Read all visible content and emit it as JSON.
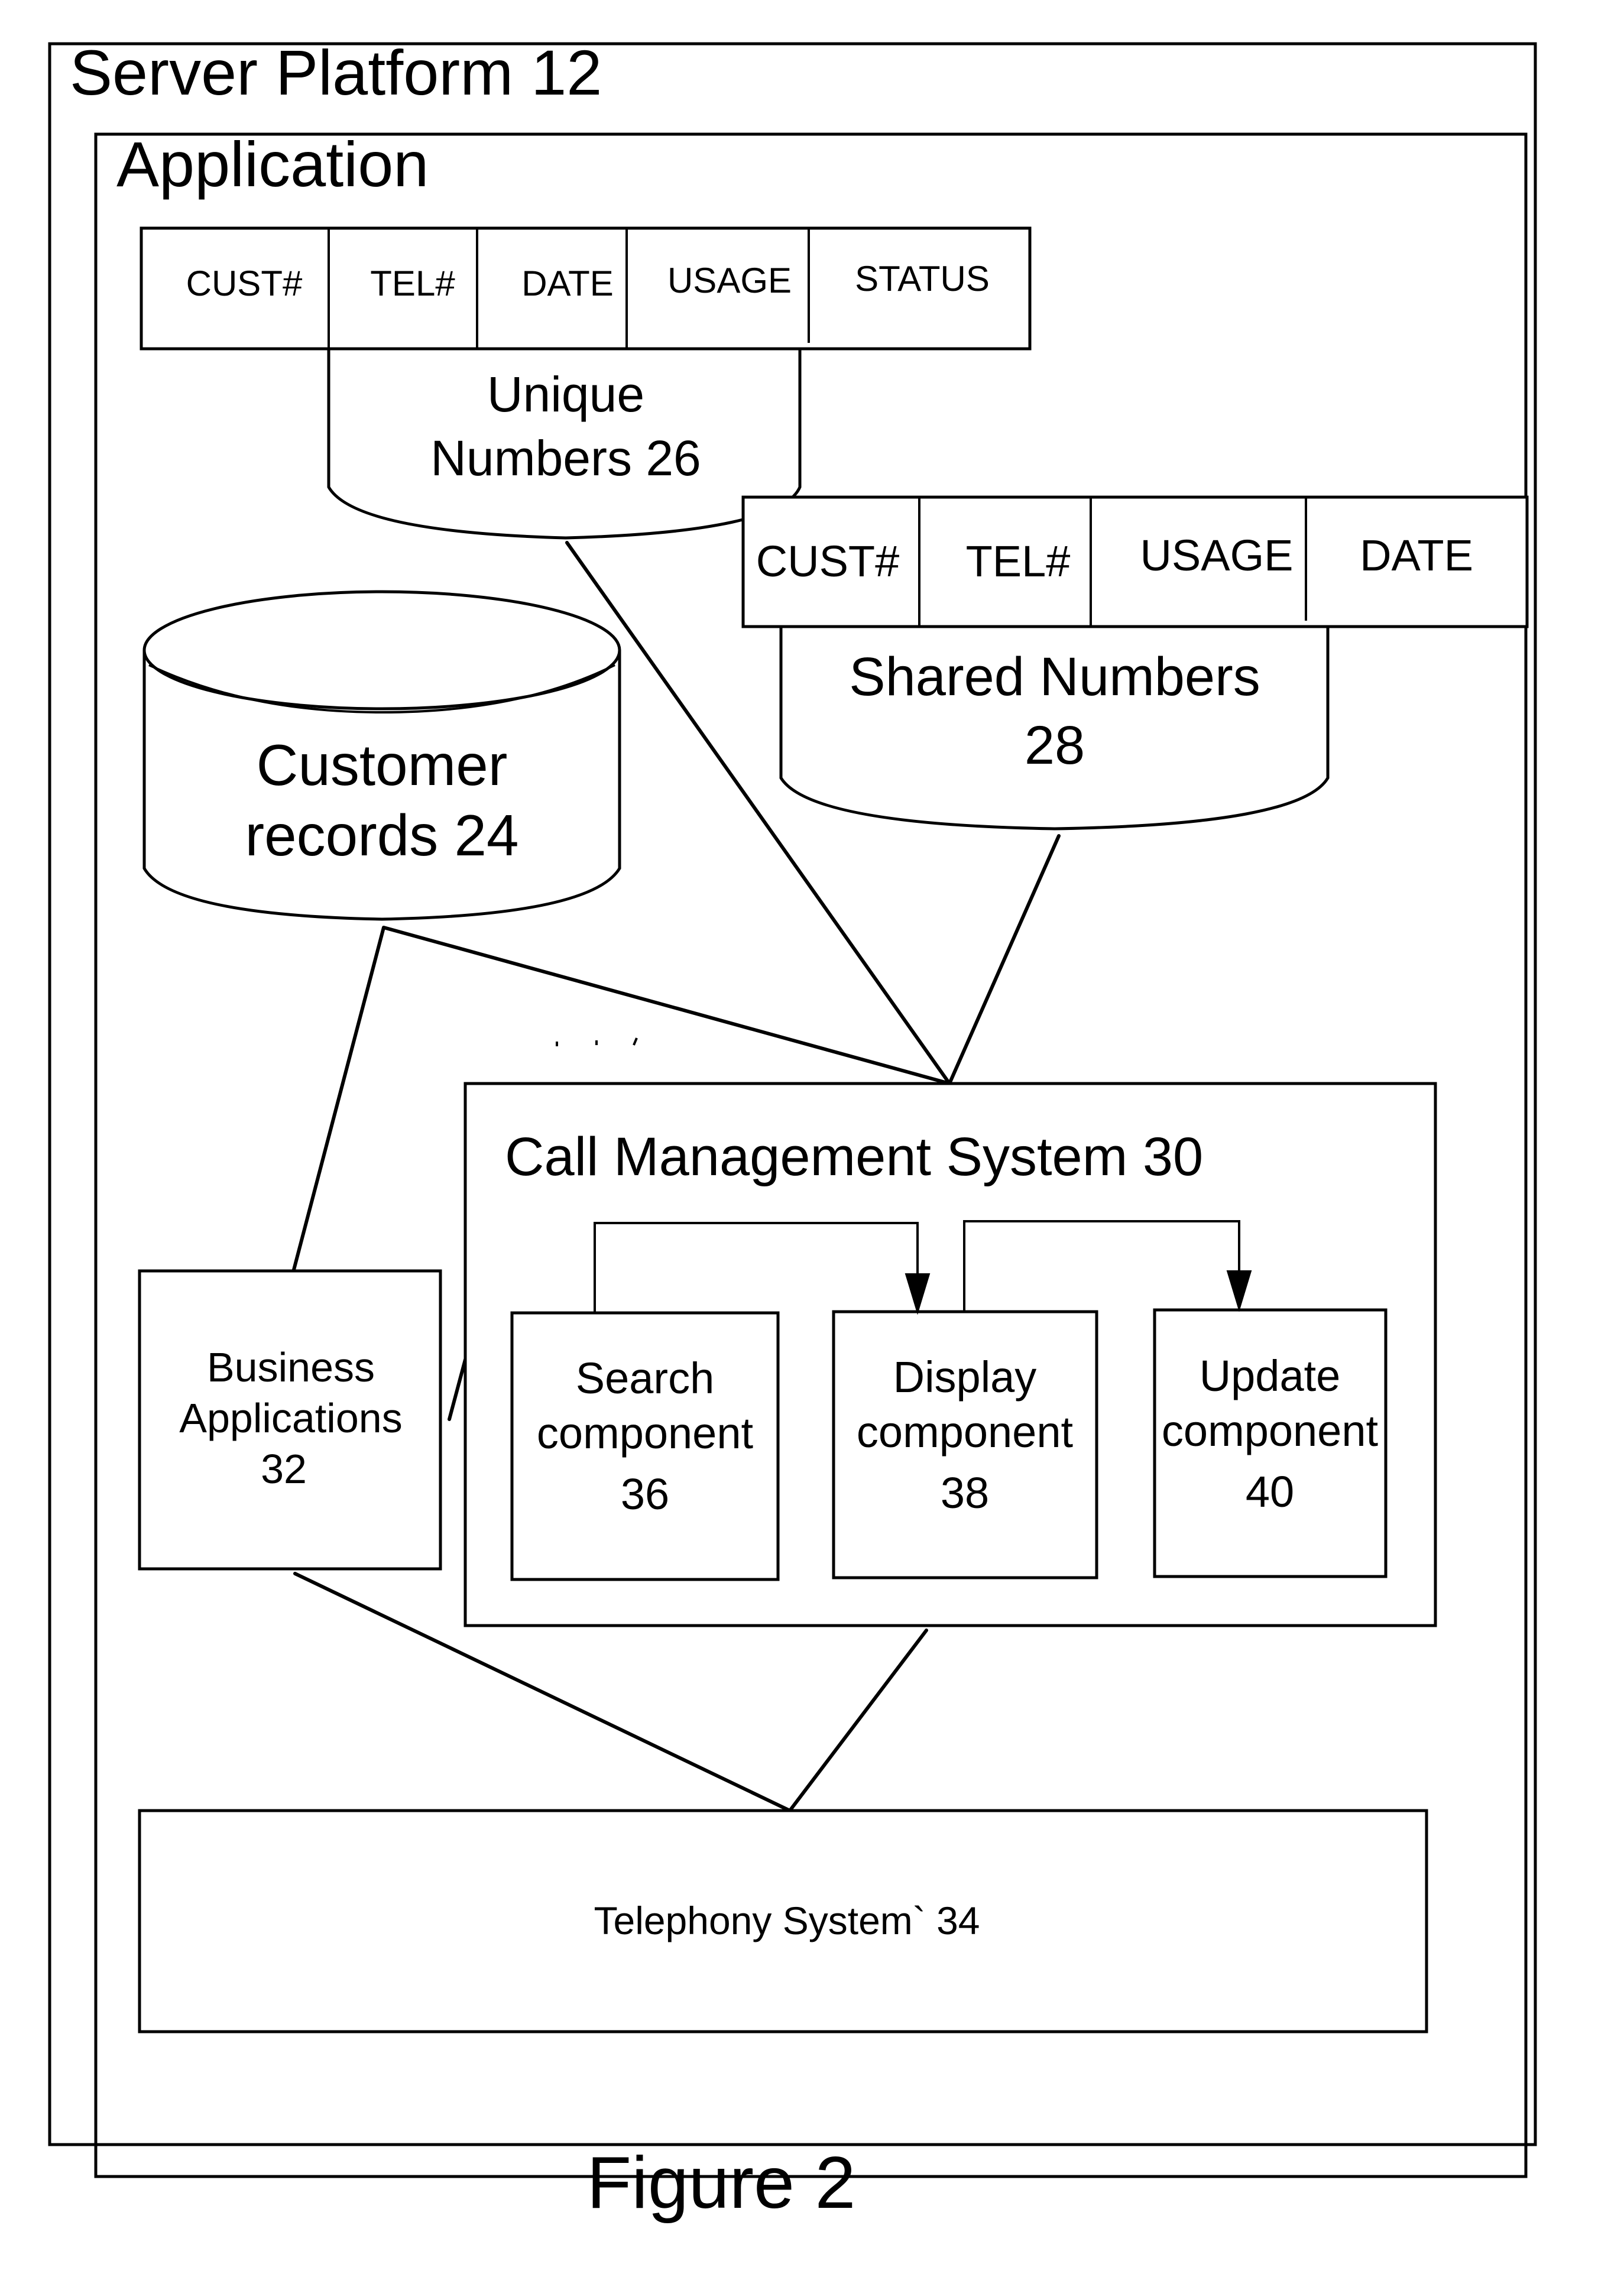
{
  "figure": {
    "caption": "Figure 2"
  },
  "server_platform": {
    "title": "Server Platform 12"
  },
  "application": {
    "title": "Application"
  },
  "unique_numbers": {
    "columns": [
      "CUST#",
      "TEL#",
      "DATE",
      "USAGE",
      "STATUS"
    ],
    "label_lines": [
      "Unique",
      "Numbers 26"
    ]
  },
  "shared_numbers": {
    "columns": [
      "CUST#",
      "TEL#",
      "USAGE",
      "DATE"
    ],
    "label_lines": [
      "Shared Numbers",
      "28"
    ]
  },
  "customer_records": {
    "label_lines": [
      "Customer",
      "records 24"
    ]
  },
  "call_management": {
    "title": "Call Management System 30",
    "components": [
      {
        "id": "search",
        "lines": [
          "Search",
          "component",
          "36"
        ]
      },
      {
        "id": "display",
        "lines": [
          "Display",
          "component",
          "38"
        ]
      },
      {
        "id": "update",
        "lines": [
          "Update",
          "component",
          "40"
        ]
      }
    ]
  },
  "business_applications": {
    "lines": [
      "Business",
      "Applications",
      "32"
    ]
  },
  "telephony": {
    "label": "Telephony System` 34"
  }
}
